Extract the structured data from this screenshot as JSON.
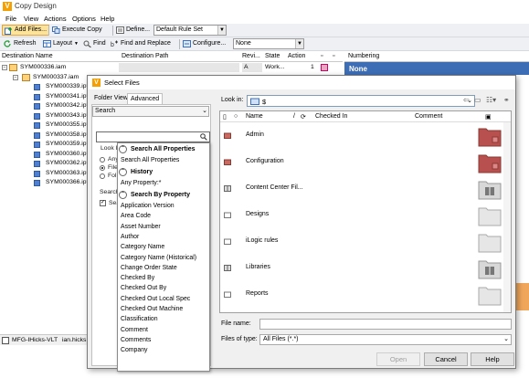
{
  "window": {
    "title": "Copy Design"
  },
  "menu": [
    "File",
    "View",
    "Actions",
    "Options",
    "Help"
  ],
  "toolbar1": {
    "add_files": "Add Files...",
    "execute_copy": "Execute Copy",
    "define": "Define...",
    "rule_set": "Default Rule Set"
  },
  "toolbar2": {
    "refresh": "Refresh",
    "layout": "Layout",
    "find": "Find",
    "find_replace": "Find and Replace",
    "configure": "Configure...",
    "config_value": "None"
  },
  "grid": {
    "columns": {
      "destination_name": "Destination Name",
      "destination_path": "Destination Path",
      "revision": "Revi...",
      "state": "State",
      "action": "Action"
    },
    "rows": [
      {
        "name": "SYM000336.iam",
        "revision": "A",
        "state": "Work...",
        "action": "1"
      },
      {
        "name": "SYM000337.iam",
        "revision": "",
        "state": "",
        "action": ""
      },
      {
        "name": "SYM000339.ipt"
      },
      {
        "name": "SYM000341.ipt"
      },
      {
        "name": "SYM000342.ipt"
      },
      {
        "name": "SYM000343.ipt"
      },
      {
        "name": "SYM000355.ipt"
      },
      {
        "name": "SYM000358.ipt"
      },
      {
        "name": "SYM000359.ipt"
      },
      {
        "name": "SYM000360.ipt"
      },
      {
        "name": "SYM000362.ipt"
      },
      {
        "name": "SYM000363.ipt"
      },
      {
        "name": "SYM000366.ipt"
      }
    ]
  },
  "numbering": {
    "header": "Numbering",
    "value": "None"
  },
  "status": {
    "server": "MFG-IHicks-VLT",
    "user": "ian.hicks"
  },
  "dialog": {
    "title": "Select Files",
    "tabs": [
      "Folder View",
      "Advanced"
    ],
    "search_mode": "Search",
    "behind": {
      "look_label": "Look I",
      "radio1": "Any",
      "radio2": "File",
      "radio3": "Fol",
      "search_label": "Search",
      "check_label": "Sea"
    },
    "popup": {
      "groups": [
        "Search All Properties",
        "History",
        "Search By Property"
      ],
      "all_props_item": "Search All Properties",
      "history_item": "Any Property:*",
      "properties": [
        "Application Version",
        "Area Code",
        "Asset Number",
        "Author",
        "Category Name",
        "Category Name (Historical)",
        "Change Order State",
        "Checked By",
        "Checked Out By",
        "Checked Out Local Spec",
        "Checked Out Machine",
        "Classification",
        "Comment",
        "Comments",
        "Company"
      ]
    },
    "look_in": {
      "label": "Look in:",
      "value": "$"
    },
    "columns": {
      "name": "Name",
      "checked_in": "Checked In",
      "comment": "Comment"
    },
    "folders": [
      {
        "name": "Admin",
        "icon": "folder-lock-icon"
      },
      {
        "name": "Configuration",
        "icon": "folder-lock-icon"
      },
      {
        "name": "Content Center Fil...",
        "icon": "library-icon"
      },
      {
        "name": "Designs",
        "icon": "folder-icon"
      },
      {
        "name": "iLogic rules",
        "icon": "folder-icon"
      },
      {
        "name": "Libraries",
        "icon": "library-icon"
      },
      {
        "name": "Reports",
        "icon": "folder-icon"
      }
    ],
    "file_name_label": "File name:",
    "file_name_value": "",
    "file_type_label": "Files of type:",
    "file_type_value": "All Files (*.*)",
    "buttons": {
      "open": "Open",
      "cancel": "Cancel",
      "help": "Help"
    }
  },
  "colors": {
    "accent": "#3d6db5",
    "highlight": "#fde39a",
    "folder_locked": "#b8504f",
    "orange": "#f5a000"
  }
}
